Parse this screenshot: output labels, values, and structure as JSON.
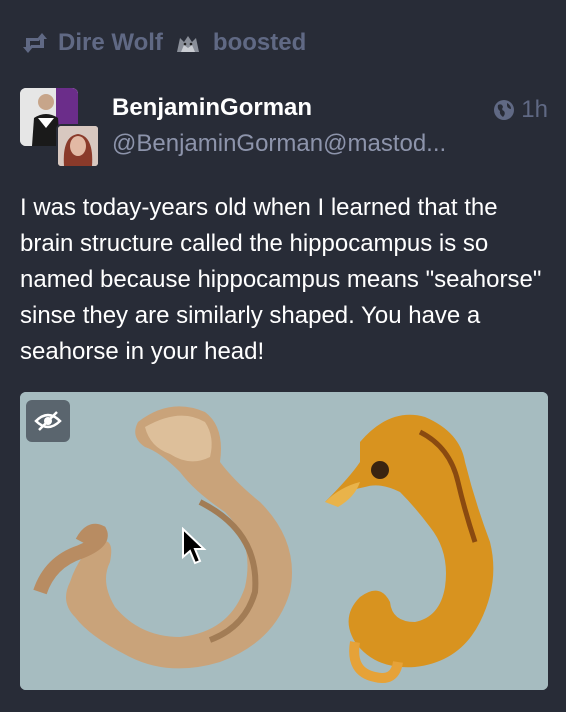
{
  "boost": {
    "booster": "Dire Wolf",
    "label": "boosted",
    "icon": "boost-icon",
    "emoji_icon": "wolf-emoji-icon"
  },
  "post": {
    "display_name": "BenjaminGorman",
    "handle": "@BenjaminGorman@mastod...",
    "time": "1h",
    "visibility_icon": "globe-icon",
    "text": "I was today-years old when I learned that the brain structure called the hippocampus is so named because hippocampus means \"seahorse\" sinse they are similarly shaped. You have a seahorse in your head!"
  },
  "media": {
    "hide_icon": "eye-slash-icon",
    "background": "#a6bcc0"
  },
  "colors": {
    "background": "#282c37",
    "muted": "#606984",
    "handle": "#8d94ab",
    "text": "#ffffff"
  }
}
